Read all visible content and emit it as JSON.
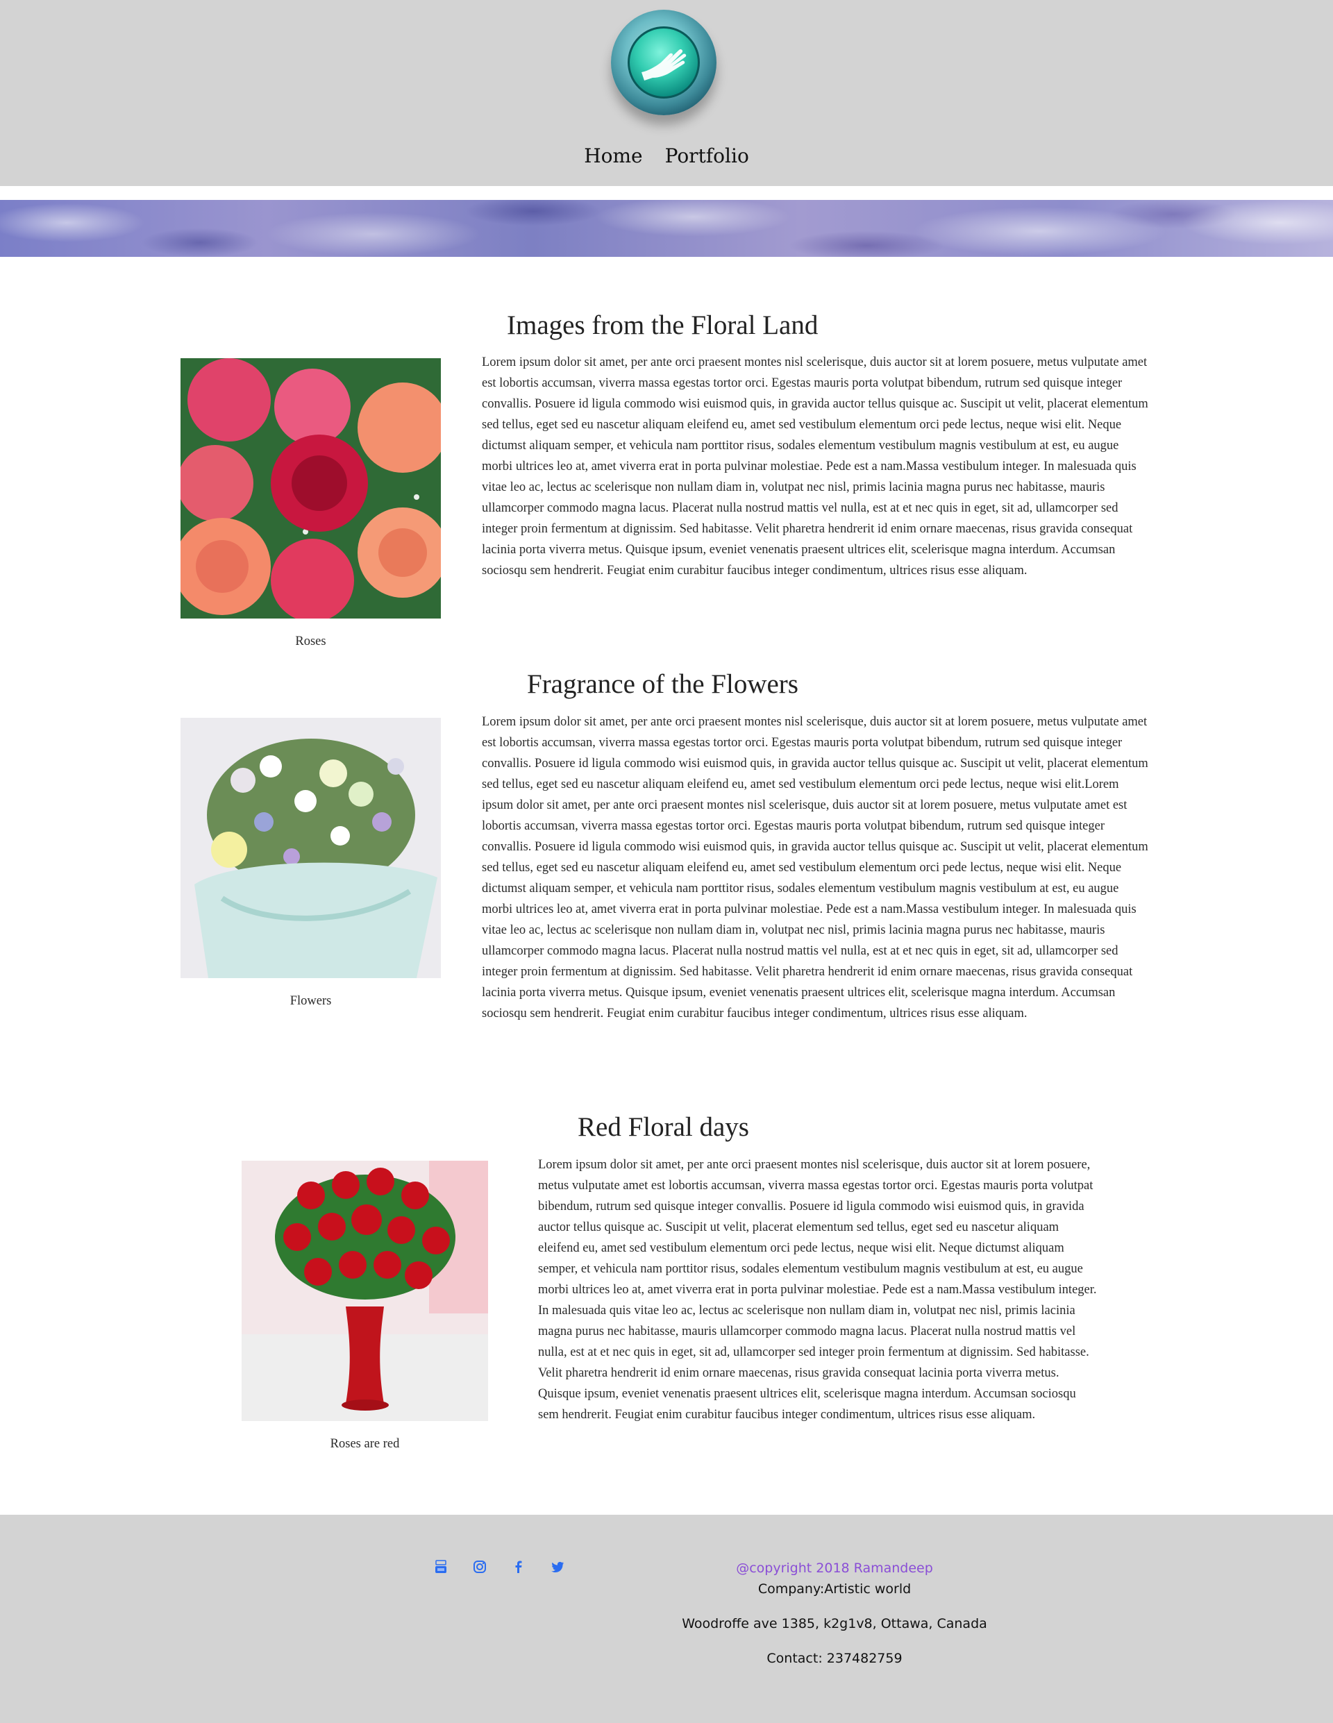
{
  "header": {
    "logo": "hand-in-circle-logo",
    "nav": [
      {
        "label": "Home"
      },
      {
        "label": "Portfolio"
      }
    ]
  },
  "banner": {
    "image": "purple-sky-clouds-banner"
  },
  "sections": [
    {
      "title": "Images from the Floral Land",
      "image": "pink-roses-bouquet",
      "caption": "Roses",
      "text": "Lorem ipsum dolor sit amet, per ante orci praesent montes nisl scelerisque, duis auctor sit at lorem posuere, metus vulputate amet est lobortis accumsan, viverra massa egestas tortor orci. Egestas mauris porta volutpat bibendum, rutrum sed quisque integer convallis. Posuere id ligula commodo wisi euismod quis, in gravida auctor tellus quisque ac. Suscipit ut velit, placerat elementum sed tellus, eget sed eu nascetur aliquam eleifend eu, amet sed vestibulum elementum orci pede lectus, neque wisi elit. Neque dictumst aliquam semper, et vehicula nam porttitor risus, sodales elementum vestibulum magnis vestibulum at est, eu augue morbi ultrices leo at, amet viverra erat in porta pulvinar molestiae. Pede est a nam.Massa vestibulum integer. In malesuada quis vitae leo ac, lectus ac scelerisque non nullam diam in, volutpat nec nisl, primis lacinia magna purus nec habitasse, mauris ullamcorper commodo magna lacus. Placerat nulla nostrud mattis vel nulla, est at et nec quis in eget, sit ad, ullamcorper sed integer proin fermentum at dignissim. Sed habitasse. Velit pharetra hendrerit id enim ornare maecenas, risus gravida consequat lacinia porta viverra metus. Quisque ipsum, eveniet venenatis praesent ultrices elit, scelerisque magna interdum. Accumsan sociosqu sem hendrerit. Feugiat enim curabitur faucibus integer condimentum, ultrices risus esse aliquam."
    },
    {
      "title": "Fragrance of the Flowers",
      "image": "mixed-flower-bouquet",
      "caption": "Flowers",
      "text": "Lorem ipsum dolor sit amet, per ante orci praesent montes nisl scelerisque, duis auctor sit at lorem posuere, metus vulputate amet est lobortis accumsan, viverra massa egestas tortor orci. Egestas mauris porta volutpat bibendum, rutrum sed quisque integer convallis. Posuere id ligula commodo wisi euismod quis, in gravida auctor tellus quisque ac. Suscipit ut velit, placerat elementum sed tellus, eget sed eu nascetur aliquam eleifend eu, amet sed vestibulum elementum orci pede lectus, neque wisi elit.Lorem ipsum dolor sit amet, per ante orci praesent montes nisl scelerisque, duis auctor sit at lorem posuere, metus vulputate amet est lobortis accumsan, viverra massa egestas tortor orci. Egestas mauris porta volutpat bibendum, rutrum sed quisque integer convallis. Posuere id ligula commodo wisi euismod quis, in gravida auctor tellus quisque ac. Suscipit ut velit, placerat elementum sed tellus, eget sed eu nascetur aliquam eleifend eu, amet sed vestibulum elementum orci pede lectus, neque wisi elit. Neque dictumst aliquam semper, et vehicula nam porttitor risus, sodales elementum vestibulum magnis vestibulum at est, eu augue morbi ultrices leo at, amet viverra erat in porta pulvinar molestiae. Pede est a nam.Massa vestibulum integer. In malesuada quis vitae leo ac, lectus ac scelerisque non nullam diam in, volutpat nec nisl, primis lacinia magna purus nec habitasse, mauris ullamcorper commodo magna lacus. Placerat nulla nostrud mattis vel nulla, est at et nec quis in eget, sit ad, ullamcorper sed integer proin fermentum at dignissim. Sed habitasse. Velit pharetra hendrerit id enim ornare maecenas, risus gravida consequat lacinia porta viverra metus. Quisque ipsum, eveniet venenatis praesent ultrices elit, scelerisque magna interdum. Accumsan sociosqu sem hendrerit. Feugiat enim curabitur faucibus integer condimentum, ultrices risus esse aliquam."
    },
    {
      "title": "Red Floral days",
      "image": "red-roses-in-vase",
      "caption": "Roses are red",
      "text": "Lorem ipsum dolor sit amet, per ante orci praesent montes nisl scelerisque, duis auctor sit at lorem posuere, metus vulputate amet est lobortis accumsan, viverra massa egestas tortor orci. Egestas mauris porta volutpat bibendum, rutrum sed quisque integer convallis. Posuere id ligula commodo wisi euismod quis, in gravida auctor tellus quisque ac. Suscipit ut velit, placerat elementum sed tellus, eget sed eu nascetur aliquam eleifend eu, amet sed vestibulum elementum orci pede lectus, neque wisi elit. Neque dictumst aliquam semper, et vehicula nam porttitor risus, sodales elementum vestibulum magnis vestibulum at est, eu augue morbi ultrices leo at, amet viverra erat in porta pulvinar molestiae. Pede est a nam.Massa vestibulum integer. In malesuada quis vitae leo ac, lectus ac scelerisque non nullam diam in, volutpat nec nisl, primis lacinia magna purus nec habitasse, mauris ullamcorper commodo magna lacus. Placerat nulla nostrud mattis vel nulla, est at et nec quis in eget, sit ad, ullamcorper sed integer proin fermentum at dignissim. Sed habitasse. Velit pharetra hendrerit id enim ornare maecenas, risus gravida consequat lacinia porta viverra metus. Quisque ipsum, eveniet venenatis praesent ultrices elit, scelerisque magna interdum. Accumsan sociosqu sem hendrerit. Feugiat enim curabitur faucibus integer condimentum, ultrices risus esse aliquam."
    }
  ],
  "footer": {
    "social": [
      {
        "icon": "youtube-icon"
      },
      {
        "icon": "instagram-icon"
      },
      {
        "icon": "facebook-icon"
      },
      {
        "icon": "twitter-icon"
      }
    ],
    "copyright": "@copyright 2018 Ramandeep",
    "company": "Company:Artistic world",
    "address": "Woodroffe ave 1385, k2g1v8, Ottawa, Canada",
    "contact": "Contact: 237482759"
  },
  "colors": {
    "header_bg": "#d3d3d3",
    "footer_bg": "#d3d3d3",
    "social_icon": "#2b6df0",
    "copyright": "#8a4ed6",
    "logo_teal": "#1fbfa6"
  }
}
